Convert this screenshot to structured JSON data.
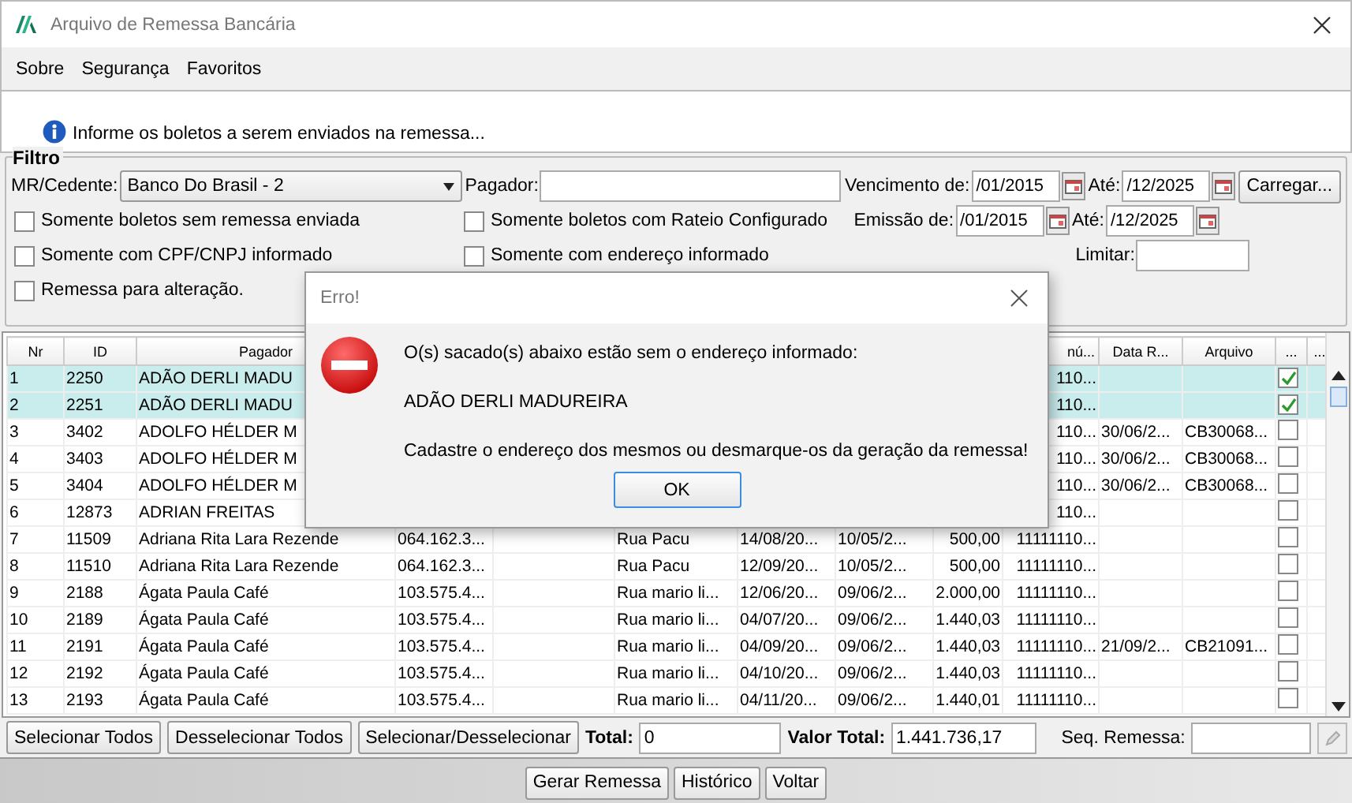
{
  "window": {
    "title": "Arquivo de Remessa Bancária"
  },
  "menu": [
    "Sobre",
    "Segurança",
    "Favoritos"
  ],
  "info": "Informe os boletos a serem enviados na remessa...",
  "filter": {
    "title": "Filtro",
    "cedente_label": "MR/Cedente:",
    "cedente_value": "Banco Do Brasil - 2",
    "pagador_label": "Pagador:",
    "vencimento_label": "Vencimento de:",
    "vencimento_from": "/01/2015",
    "vencimento_to_label": "Até:",
    "vencimento_to": "/12/2025",
    "load_button": "Carregar...",
    "emissao_label": "Emissão de:",
    "emissao_from": "/01/2015",
    "emissao_to_label": "Até:",
    "emissao_to": "/12/2025",
    "limit_label": "Limitar:",
    "checkboxes": [
      {
        "label": "Somente boletos sem remessa enviada",
        "checked": false
      },
      {
        "label": "Somente boletos com Rateio Configurado",
        "checked": false
      },
      {
        "label": "Somente com CPF/CNPJ informado",
        "checked": false
      },
      {
        "label": "Somente com endereço informado",
        "checked": false
      },
      {
        "label": "Remessa para alteração.",
        "checked": false
      }
    ]
  },
  "table": {
    "columns": [
      "Nr",
      "ID",
      "Pagador",
      null,
      null,
      null,
      null,
      null,
      null,
      "nú...",
      "Data R...",
      "Arquivo",
      "...",
      "..."
    ],
    "rows": [
      {
        "selected": true,
        "checked": true,
        "cells": [
          "1",
          "2250",
          "ADÃO DERLI MADU",
          null,
          null,
          null,
          null,
          null,
          null,
          "110...",
          null,
          null
        ]
      },
      {
        "selected": true,
        "checked": true,
        "cells": [
          "2",
          "2251",
          "ADÃO DERLI MADU",
          null,
          null,
          null,
          null,
          null,
          null,
          "110...",
          null,
          null
        ]
      },
      {
        "selected": false,
        "checked": false,
        "cells": [
          "3",
          "3402",
          "ADOLFO HÉLDER M",
          null,
          null,
          null,
          null,
          null,
          null,
          "110...",
          "30/06/2...",
          "CB30068..."
        ]
      },
      {
        "selected": false,
        "checked": false,
        "cells": [
          "4",
          "3403",
          "ADOLFO HÉLDER M",
          null,
          null,
          null,
          null,
          null,
          null,
          "110...",
          "30/06/2...",
          "CB30068..."
        ]
      },
      {
        "selected": false,
        "checked": false,
        "cells": [
          "5",
          "3404",
          "ADOLFO HÉLDER M",
          null,
          null,
          null,
          null,
          null,
          null,
          "110...",
          "30/06/2...",
          "CB30068..."
        ]
      },
      {
        "selected": false,
        "checked": false,
        "cells": [
          "6",
          "12873",
          "ADRIAN FREITAS",
          null,
          null,
          null,
          null,
          null,
          null,
          "110...",
          null,
          null
        ]
      },
      {
        "selected": false,
        "checked": false,
        "cells": [
          "7",
          "11509",
          "Adriana Rita Lara Rezende",
          "064.162.3...",
          null,
          "Rua Pacu",
          "14/08/20...",
          "10/05/2...",
          "500,00",
          "11111110...",
          null,
          null
        ]
      },
      {
        "selected": false,
        "checked": false,
        "cells": [
          "8",
          "11510",
          "Adriana Rita Lara Rezende",
          "064.162.3...",
          null,
          "Rua Pacu",
          "12/09/20...",
          "10/05/2...",
          "500,00",
          "11111110...",
          null,
          null
        ]
      },
      {
        "selected": false,
        "checked": false,
        "cells": [
          "9",
          "2188",
          "Ágata Paula Café",
          "103.575.4...",
          null,
          "Rua mario li...",
          "12/06/20...",
          "09/06/2...",
          "2.000,00",
          "11111110...",
          null,
          null
        ]
      },
      {
        "selected": false,
        "checked": false,
        "cells": [
          "10",
          "2189",
          "Ágata Paula Café",
          "103.575.4...",
          null,
          "Rua mario li...",
          "04/07/20...",
          "09/06/2...",
          "1.440,03",
          "11111110...",
          null,
          null
        ]
      },
      {
        "selected": false,
        "checked": false,
        "cells": [
          "11",
          "2191",
          "Ágata Paula Café",
          "103.575.4...",
          null,
          "Rua mario li...",
          "04/09/20...",
          "09/06/2...",
          "1.440,03",
          "11111110...",
          "21/09/2...",
          "CB21091..."
        ]
      },
      {
        "selected": false,
        "checked": false,
        "cells": [
          "12",
          "2192",
          "Ágata Paula Café",
          "103.575.4...",
          null,
          "Rua mario li...",
          "04/10/20...",
          "09/06/2...",
          "1.440,03",
          "11111110...",
          null,
          null
        ]
      },
      {
        "selected": false,
        "checked": false,
        "cells": [
          "13",
          "2193",
          "Ágata Paula Café",
          "103.575.4...",
          null,
          "Rua mario li...",
          "04/11/20...",
          "09/06/2...",
          "1.440,01",
          "11111110...",
          null,
          null
        ]
      }
    ]
  },
  "actions": [
    "Selecionar Todos",
    "Desselecionar Todos",
    "Selecionar/Desselecionar"
  ],
  "totals": {
    "total_label": "Total:",
    "total_value": "0",
    "valor_label": "Valor Total:",
    "valor_value": "1.441.736,17",
    "seq_label": "Seq. Remessa:"
  },
  "footer_buttons": [
    "Gerar Remessa",
    "Histórico",
    "Voltar"
  ],
  "dialog": {
    "title": "Erro!",
    "lines": [
      "O(s) sacado(s) abaixo estão sem o endereço informado:",
      "ADÃO DERLI MADUREIRA",
      "Cadastre o endereço dos mesmos ou desmarque-os da geração da remessa!"
    ],
    "button": "OK"
  }
}
